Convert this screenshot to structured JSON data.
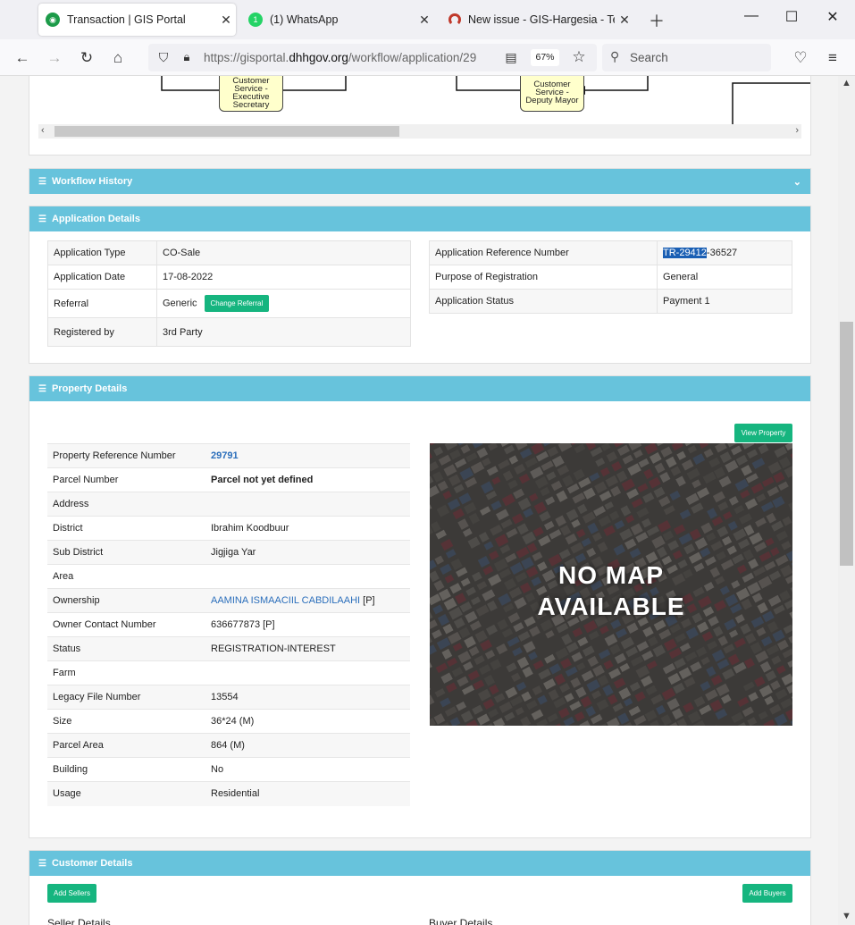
{
  "browser": {
    "tabs": [
      {
        "title": "Transaction | GIS Portal",
        "active": true
      },
      {
        "title": "(1) WhatsApp",
        "badge": "1"
      },
      {
        "title": "New issue - GIS-Hargesia - Team"
      }
    ],
    "url_prefix": "https://gisportal.",
    "url_domain": "dhhgov.org",
    "url_path": "/workflow/application/29",
    "zoom": "67%",
    "search_placeholder": "Search"
  },
  "workflow_diagram": {
    "nodes": [
      "Customer Service - Executive Secretary",
      "Customer Service - Deputy Mayor"
    ]
  },
  "workflow_history": {
    "title": "Workflow History"
  },
  "application_details": {
    "title": "Application Details",
    "left": [
      {
        "label": "Application Type",
        "value": "CO-Sale"
      },
      {
        "label": "Application Date",
        "value": "17-08-2022"
      },
      {
        "label": "Referral",
        "value": "Generic"
      },
      {
        "label": "Registered by",
        "value": "3rd Party"
      }
    ],
    "change_referral_label": "Change Referral",
    "right": [
      {
        "label": "Application Reference Number",
        "value_highlight": "TR-29412",
        "value_rest": "-36527"
      },
      {
        "label": "Purpose of Registration",
        "value": "General"
      },
      {
        "label": "Application Status",
        "value": "Payment 1"
      }
    ]
  },
  "property_details": {
    "title": "Property Details",
    "view_property_label": "View Property",
    "map_text_line1": "NO MAP",
    "map_text_line2": "AVAILABLE",
    "rows": [
      {
        "label": "Property Reference Number",
        "value": "29791"
      },
      {
        "label": "Parcel Number",
        "value": "Parcel not yet defined"
      },
      {
        "label": "Address",
        "value": ""
      },
      {
        "label": "District",
        "value": "Ibrahim Koodbuur"
      },
      {
        "label": "Sub District",
        "value": "Jigjiga Yar"
      },
      {
        "label": "Area",
        "value": ""
      },
      {
        "label": "Ownership",
        "value": "AAMINA ISMAACIIL CABDILAAHI",
        "suffix": "[P]"
      },
      {
        "label": "Owner Contact Number",
        "value": "636677873 [P]"
      },
      {
        "label": "Status",
        "value": "REGISTRATION-INTEREST"
      },
      {
        "label": "Farm",
        "value": ""
      },
      {
        "label": "Legacy File Number",
        "value": "13554"
      },
      {
        "label": "Size",
        "value": "36*24 (M)"
      },
      {
        "label": "Parcel Area",
        "value": "864 (M)"
      },
      {
        "label": "Building",
        "value": "No"
      },
      {
        "label": "Usage",
        "value": "Residential"
      }
    ]
  },
  "customer_details": {
    "title": "Customer Details",
    "add_sellers_label": "Add Sellers",
    "add_buyers_label": "Add Buyers",
    "seller_heading": "Seller Details",
    "buyer_heading": "Buyer Details"
  },
  "colors": {
    "section_header": "#67c3dc",
    "button_green": "#16b57f",
    "link_blue": "#2a6ebb",
    "highlight": "#1a5fb4"
  }
}
